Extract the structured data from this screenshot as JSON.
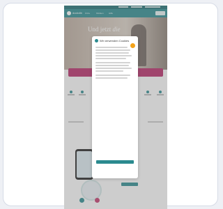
{
  "site": {
    "logo_text": "doctolib",
    "nav": [
      "Ärzte",
      "Kliniken",
      "Hilfe",
      "Login"
    ],
    "hero_title_main": "Und jetzt",
    "hero_title_em": "die"
  },
  "consent": {
    "title": "Wir verwenden Cookies",
    "accept_label": "",
    "settings_link": "",
    "decline_link": ""
  },
  "colors": {
    "brand": "#2b8a8f",
    "brand_dark": "#1e6f74",
    "banner": "#b62a67",
    "badge": "#f4a31a"
  }
}
